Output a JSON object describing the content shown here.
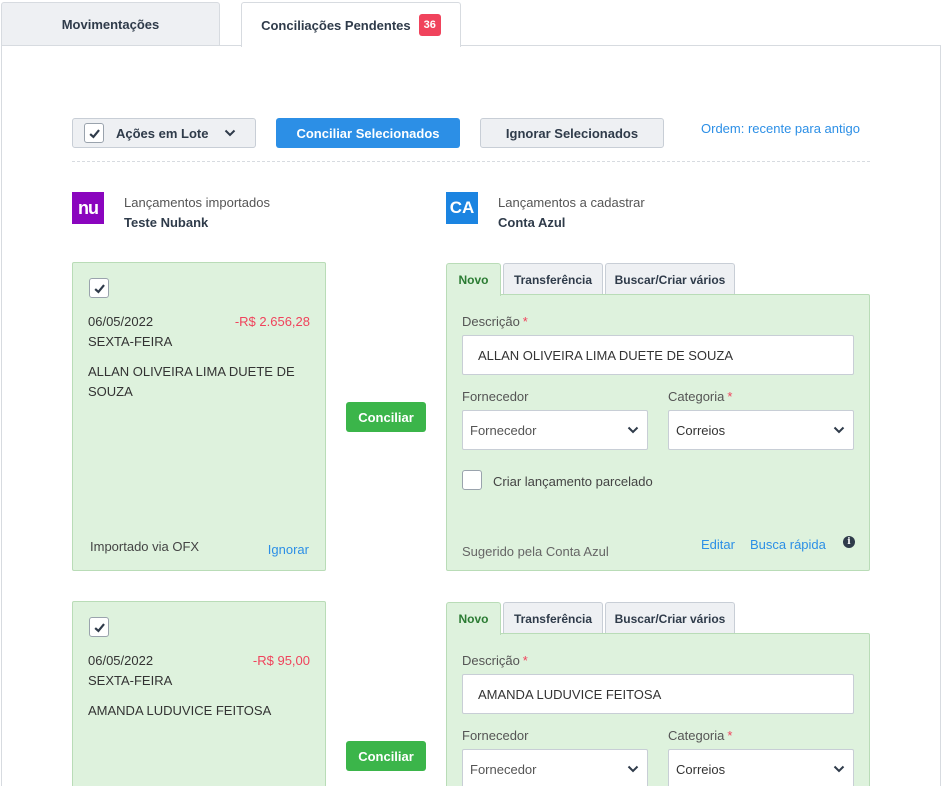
{
  "tabs": [
    {
      "label": "Movimentações"
    },
    {
      "label": "Conciliações Pendentes",
      "badge": "36"
    }
  ],
  "toolbar": {
    "batch_label": "Ações em Lote",
    "reconcile_selected": "Conciliar Selecionados",
    "ignore_selected": "Ignorar Selecionados",
    "order_label": "Ordem: recente para antigo"
  },
  "sources": {
    "imported": {
      "label": "Lançamentos importados",
      "name": "Teste Nubank",
      "logo_text": "nu"
    },
    "to_register": {
      "label": "Lançamentos a cadastrar",
      "name": "Conta Azul",
      "logo_text": "CA"
    }
  },
  "form_tabs": [
    "Novo",
    "Transferência",
    "Buscar/Criar vários"
  ],
  "labels": {
    "description": "Descrição",
    "supplier": "Fornecedor",
    "category": "Categoria",
    "installment": "Criar lançamento parcelado",
    "suggested": "Sugerido pela Conta Azul",
    "edit": "Editar",
    "quick_search": "Busca rápida",
    "reconcile": "Conciliar",
    "imported_via": "Importado via OFX",
    "ignore": "Ignorar",
    "required": "*",
    "info": "i"
  },
  "transactions": [
    {
      "date": "06/05/2022",
      "weekday": "SEXTA-FEIRA",
      "amount": "-R$ 2.656,28",
      "description": "ALLAN OLIVEIRA LIMA DUETE DE SOUZA",
      "form": {
        "description": "ALLAN OLIVEIRA LIMA DUETE DE SOUZA",
        "supplier_placeholder": "Fornecedor",
        "category": "Correios"
      }
    },
    {
      "date": "06/05/2022",
      "weekday": "SEXTA-FEIRA",
      "amount": "-R$ 95,00",
      "description": "AMANDA LUDUVICE FEITOSA",
      "form": {
        "description": "AMANDA LUDUVICE FEITOSA",
        "supplier_placeholder": "Fornecedor",
        "category": "Correios"
      }
    }
  ],
  "colors": {
    "primary": "#2c8fe6",
    "success": "#3bb54a",
    "card_bg": "#def2dd",
    "negative": "#f0435c",
    "nubank": "#8a05be"
  }
}
